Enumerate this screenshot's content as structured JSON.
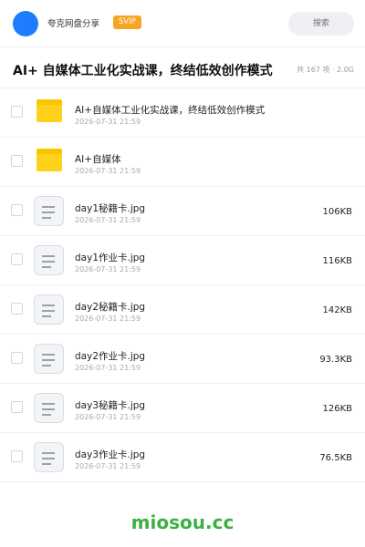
{
  "header": {
    "app_name": "夸克网盘分享",
    "badge": "SVIP",
    "search_placeholder": "搜索"
  },
  "folder": {
    "title": "AI+ 自媒体工业化实战课，终结低效创作模式",
    "meta": "共 167 项 · 2.0G"
  },
  "items": [
    {
      "type": "folder",
      "name": "AI+自媒体工业化实战课，终结低效创作模式",
      "date": "2026-07-31 21:59",
      "size": ""
    },
    {
      "type": "folder",
      "name": "AI+自媒体",
      "date": "2026-07-31 21:59",
      "size": ""
    },
    {
      "type": "file",
      "name": "day1秘籍卡.jpg",
      "date": "2026-07-31 21:59",
      "size": "106KB"
    },
    {
      "type": "file",
      "name": "day1作业卡.jpg",
      "date": "2026-07-31 21:59",
      "size": "116KB"
    },
    {
      "type": "file",
      "name": "day2秘籍卡.jpg",
      "date": "2026-07-31 21:59",
      "size": "142KB"
    },
    {
      "type": "file",
      "name": "day2作业卡.jpg",
      "date": "2026-07-31 21:59",
      "size": "93.3KB"
    },
    {
      "type": "file",
      "name": "day3秘籍卡.jpg",
      "date": "2026-07-31 21:59",
      "size": "126KB"
    },
    {
      "type": "file",
      "name": "day3作业卡.jpg",
      "date": "2026-07-31 21:59",
      "size": "76.5KB"
    }
  ],
  "watermark": "miosou.cc",
  "colors": {
    "avatar": "#1e7cff",
    "badge": "#f5a623",
    "folder": "#ffd11a",
    "watermark": "#3cb043"
  }
}
